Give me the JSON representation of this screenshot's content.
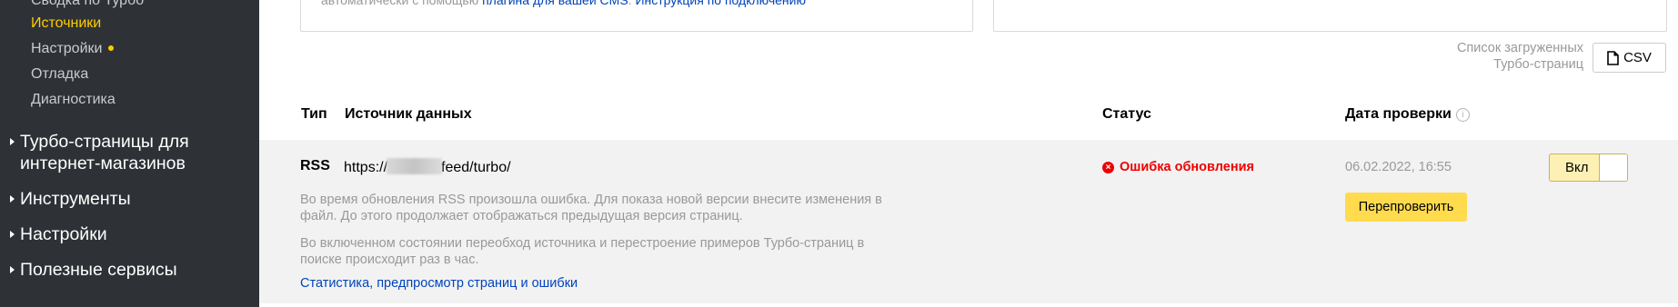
{
  "sidebar": {
    "sub_items": [
      {
        "label": "Сводка по Турбо"
      },
      {
        "label": "Источники"
      },
      {
        "label": "Настройки"
      },
      {
        "label": "Отладка"
      },
      {
        "label": "Диагностика"
      }
    ],
    "sections": [
      {
        "label_line1": "Турбо-страницы для",
        "label_line2": "интернет-магазинов"
      },
      {
        "label": "Инструменты"
      },
      {
        "label": "Настройки"
      },
      {
        "label": "Полезные сервисы"
      }
    ]
  },
  "top_box": {
    "text_prefix": "автоматически с помощью ",
    "plugin_link": "плагина для вашей CMS",
    "separator": ". ",
    "instruction_link": "Инструкция по подключению"
  },
  "csv": {
    "caption_line1": "Список загруженных",
    "caption_line2": "Турбо-страниц",
    "button_label": "CSV",
    "icon": "document-icon"
  },
  "table": {
    "headers": {
      "type": "Тип",
      "source": "Источник данных",
      "status": "Статус",
      "date": "Дата проверки"
    },
    "row": {
      "type": "RSS",
      "url_prefix": "https://",
      "url_suffix": "feed/turbo/",
      "desc1": "Во время обновления RSS произошла ошибка. Для показа новой версии внесите изменения в файл. До этого продолжает отображаться предыдущая версия страниц.",
      "desc2": "Во включенном состоянии переобход источника и перестроение примеров Турбо-страниц в поиске происходит раз в час.",
      "link": "Статистика, предпросмотр страниц и ошибки",
      "status": "Ошибка обновления",
      "date": "06.02.2022, 16:55",
      "recheck_label": "Перепроверить",
      "toggle_label": "Вкл"
    }
  },
  "colors": {
    "sidebar_bg": "#2e3236",
    "accent_yellow": "#ffcc00",
    "error_red": "#e00",
    "link_blue": "#04b",
    "button_yellow": "#ffdb4d",
    "row_bg": "#f2f2f2"
  }
}
